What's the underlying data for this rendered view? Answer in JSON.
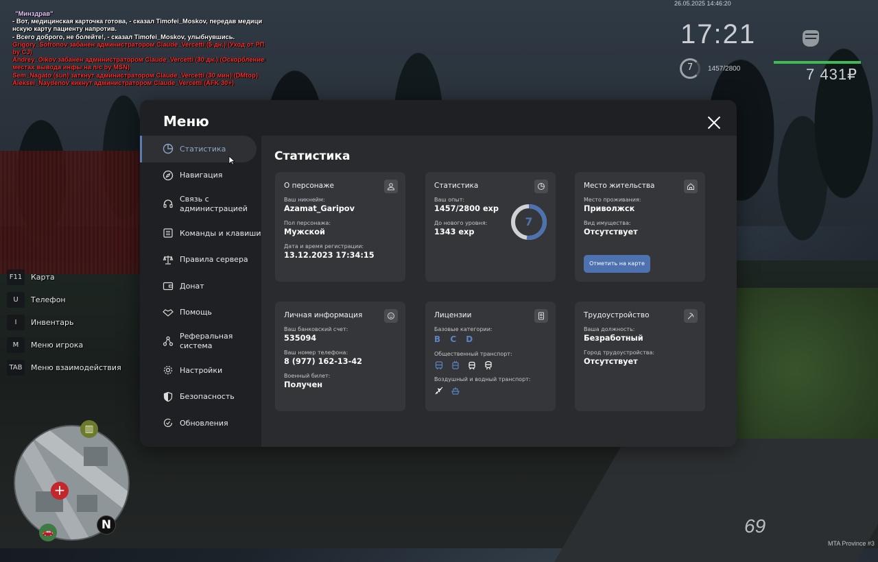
{
  "chat": [
    {
      "text": "\"Минздрав\"",
      "color": "title"
    },
    {
      "text": "- Вот, медицинская карточка готова, - сказал Timofei_Moskov, передав медици",
      "color": "white"
    },
    {
      "text": "нскую карту пациенту напротив.",
      "color": "white"
    },
    {
      "text": "- Всего доброго, не болейте!, - сказал Timofei_Moskov, улыбнувшись.",
      "color": "white"
    },
    {
      "text": "Grigory_Sofronov забанен администратором Claude_Vercetti (5 дн.) (Уход от РП",
      "color": "red"
    },
    {
      "text": " by CJ)",
      "color": "red"
    },
    {
      "text": "Andrey_Olkov забанен администратором Claude_Vercetti (30 дн.) (Оскорбление в",
      "color": "red"
    },
    {
      "text": "местах вывода инфы на п/с by MSN)",
      "color": "red"
    },
    {
      "text": "Sem_Nagato (sun) заткнут администратором Claude_Vercetti (30 мин) (DMtop)",
      "color": "red"
    },
    {
      "text": "Aleksei_Naydenov кикнут администратором Claude_Vercetti (AFK 30+)",
      "color": "red"
    }
  ],
  "hud": {
    "date": "26.05.2025 14:46:20",
    "time": "17:21",
    "level": "7",
    "exp": "1457/2800",
    "money": "7 431₽",
    "speed": "69",
    "server": "MTA Province #3",
    "health_fraction": 1.0
  },
  "keys": [
    {
      "key": "F11",
      "label": "Карта"
    },
    {
      "key": "U",
      "label": "Телефон"
    },
    {
      "key": "I",
      "label": "Инвентарь"
    },
    {
      "key": "M",
      "label": "Меню игрока"
    },
    {
      "key": "TAB",
      "label": "Меню взаимодействия"
    }
  ],
  "minimap": {
    "north": "N",
    "hospital": "+"
  },
  "menu": {
    "title": "Меню",
    "nav": [
      {
        "label": "Статистика",
        "icon": "pie-chart-icon",
        "active": true
      },
      {
        "label": "Навигация",
        "icon": "compass-icon"
      },
      {
        "label": "Связь с администрацией",
        "icon": "headset-icon"
      },
      {
        "label": "Команды и клавиши",
        "icon": "list-icon"
      },
      {
        "label": "Правила сервера",
        "icon": "scales-icon"
      },
      {
        "label": "Донат",
        "icon": "wallet-icon"
      },
      {
        "label": "Помощь",
        "icon": "handshake-icon"
      },
      {
        "label": "Реферальная система",
        "icon": "network-icon"
      },
      {
        "label": "Настройки",
        "icon": "gear-icon"
      },
      {
        "label": "Безопасность",
        "icon": "shield-icon"
      },
      {
        "label": "Обновления",
        "icon": "refresh-check-icon"
      }
    ],
    "content_title": "Статистика",
    "cards": {
      "character": {
        "title": "О персонаже",
        "nick_label": "Ваш никнейм:",
        "nick": "Azamat_Garipov",
        "gender_label": "Пол персонажа:",
        "gender": "Мужской",
        "reg_label": "Дата и время регистрации:",
        "reg": "13.12.2023 17:34:15"
      },
      "stats": {
        "title": "Статистика",
        "exp_label": "Ваш опыт:",
        "exp": "1457/2800 exp",
        "next_label": "До нового уровня:",
        "next": "1343 exp",
        "level": "7",
        "progress": 0.52
      },
      "residence": {
        "title": "Место жительства",
        "place_label": "Место проживания:",
        "place": "Приволжск",
        "property_label": "Вид имущества:",
        "property": "Отсутствует",
        "button": "Отметить на карте"
      },
      "personal": {
        "title": "Личная информация",
        "bank_label": "Ваш банковский счет:",
        "bank": "535094",
        "phone_label": "Ваш номер телефона:",
        "phone": "8 (977) 162-13-42",
        "military_label": "Военный билет:",
        "military": "Получен"
      },
      "licenses": {
        "title": "Лицензии",
        "base_label": "Базовые категории:",
        "base": "B C D",
        "public_label": "Общественный транспорт:",
        "air_label": "Воздушный и водный транспорт:"
      },
      "job": {
        "title": "Трудоустройство",
        "position_label": "Ваша должность:",
        "position": "Безработный",
        "city_label": "Город трудоустройства:",
        "city": "Отсутствует"
      }
    }
  },
  "colors": {
    "accent": "#4e72b0",
    "panel": "#1f2023",
    "card": "#353639"
  }
}
